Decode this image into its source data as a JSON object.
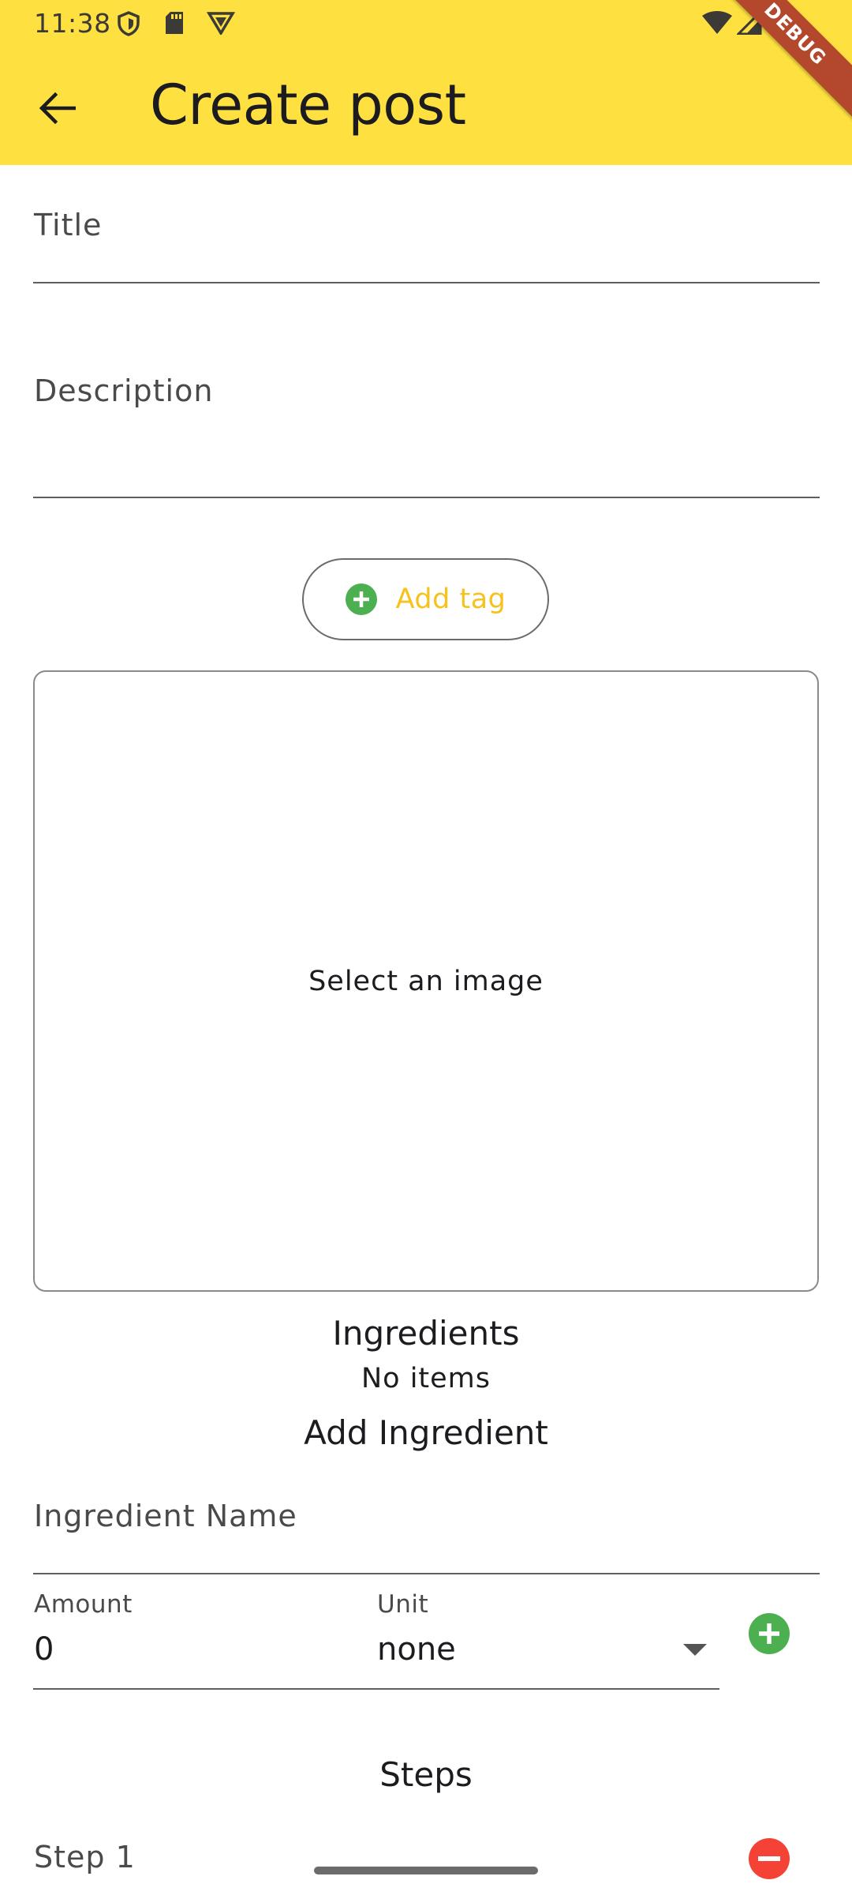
{
  "status_bar": {
    "time": "11:38"
  },
  "app_bar": {
    "title": "Create post",
    "debug_banner": "DEBUG",
    "background_color": "#fee140"
  },
  "form": {
    "title_label": "Title",
    "description_label": "Description",
    "add_tag_label": "Add tag",
    "image_placeholder": "Select an image"
  },
  "ingredients": {
    "heading": "Ingredients",
    "empty_text": "No items",
    "add_heading": "Add Ingredient",
    "name_label": "Ingredient Name",
    "amount_label": "Amount",
    "amount_value": "0",
    "unit_label": "Unit",
    "unit_value": "none"
  },
  "steps": {
    "heading": "Steps",
    "items": [
      {
        "label": "Step 1"
      }
    ]
  },
  "icons": {
    "back": "arrow-back-icon",
    "add": "add-circle-icon",
    "remove": "remove-circle-icon",
    "dropdown": "dropdown-arrow-icon"
  },
  "colors": {
    "accent_yellow": "#f6c21d",
    "add_green": "#4caf50",
    "remove_red": "#f44336"
  }
}
